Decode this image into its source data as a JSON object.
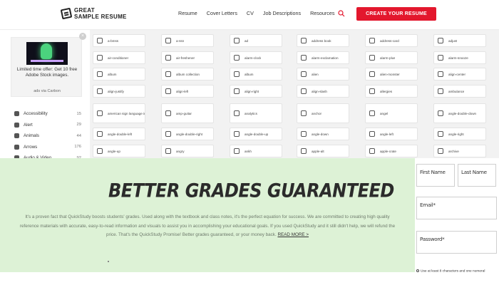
{
  "header": {
    "logo_line1": "GREAT",
    "logo_line2": "SAMPLE RESUME",
    "nav": [
      "Resume",
      "Cover Letters",
      "CV",
      "Job Descriptions",
      "Resources"
    ],
    "cta_label": "CREATE YOUR RESUME",
    "accent_color": "#e3172d"
  },
  "ad": {
    "close_label": "×",
    "text": "Limited time offer: Get 10 free Adobe Stock images.",
    "via": "ads via Carbon"
  },
  "categories": [
    {
      "label": "Accessibility",
      "count": "15"
    },
    {
      "label": "Alert",
      "count": "29"
    },
    {
      "label": "Animals",
      "count": "44"
    },
    {
      "label": "Arrows",
      "count": "176"
    },
    {
      "label": "Audio & Video",
      "count": "92"
    }
  ],
  "icons": [
    [
      "a-bmss",
      "a-ssn",
      "ad",
      "address book",
      "address-card",
      "adjust"
    ],
    [
      "air-conditioner",
      "air-freshener",
      "alarm-clock",
      "alarm-exclamation",
      "alarm-plus",
      "alarm-snooze"
    ],
    [
      "album",
      "album collection",
      "album",
      "alien",
      "alien-monster",
      "align-center"
    ],
    [
      "align-justify",
      "align-left",
      "align-right",
      "align-slash",
      "allergies",
      "ambulance"
    ],
    [
      "american sign language interpreting",
      "amp-guitar",
      "analytics",
      "anchor",
      "angel",
      "angle-double-down"
    ],
    [
      "angle-double-left",
      "angle-double-right",
      "angle-double-up",
      "angle-down",
      "angle-left",
      "angle-right"
    ],
    [
      "angle-up",
      "angry",
      "ankh",
      "apple-alt",
      "apple-crate",
      "archive"
    ]
  ],
  "promo": {
    "title": "BETTER GRADES GUARANTEED",
    "body": "It's a proven fact that QuickStudy boosts students' grades. Used along with the textbook and class notes, it's the perfect equation for success. We are committed to creating high quality reference materials with accurate, easy-to-read information and visuals to assist you in accomplishing your educational goals. If you used QuickStudy and it still didn't help, we will refund the price. That's the QuickStudy Promise! Better grades guaranteed, or your money back.",
    "link": "READ MORE >",
    "bg_color": "#ddf2d6"
  },
  "form": {
    "first_name": "First Name",
    "last_name": "Last Name",
    "email": "Email*",
    "password": "Password*",
    "note": "Use at least 8 characters and one numeral"
  }
}
